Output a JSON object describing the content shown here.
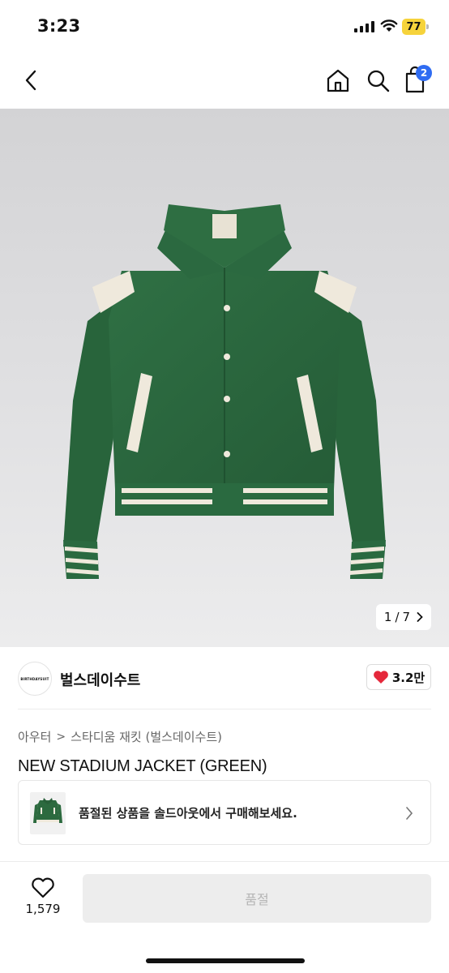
{
  "status_bar": {
    "time": "3:23",
    "battery": "77"
  },
  "nav": {
    "cart_count": "2"
  },
  "image": {
    "counter_current": "1",
    "counter_sep": "/",
    "counter_total": "7"
  },
  "brand": {
    "logo_text": "BIRTHDAYSUIT",
    "name": "벌스데이수트",
    "likes": "3.2만"
  },
  "breadcrumb": {
    "category": "아우터",
    "separator": ">",
    "subcategory": "스타디움 재킷 (벌스데이수트)"
  },
  "product": {
    "title": "NEW STADIUM JACKET (GREEN)"
  },
  "soldout_banner": {
    "text": "품절된 상품을 솔드아웃에서 구매해보세요."
  },
  "bottom_bar": {
    "wish_count": "1,579",
    "buy_label": "품절"
  },
  "colors": {
    "jacket_green": "#2c6a3f",
    "cream": "#efe9dc",
    "badge_blue": "#2f6cf2",
    "battery_yellow": "#f6d33b",
    "heart_red": "#e5283b"
  }
}
